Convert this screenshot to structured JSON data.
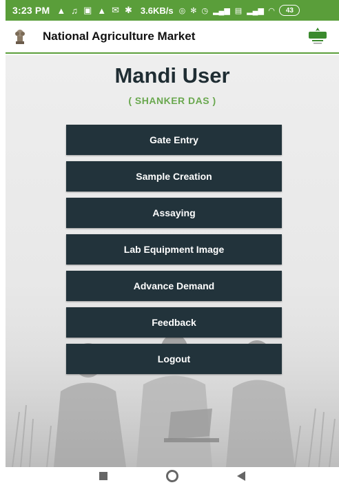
{
  "status_bar": {
    "time": "3:23 PM",
    "speed": "3.6KB/s",
    "battery": "43",
    "icons": [
      "warning-icon",
      "notification-icon",
      "download-icon",
      "warning-icon",
      "mail-icon",
      "fan-icon"
    ],
    "right_icons": [
      "hotspot-icon",
      "bluetooth-icon",
      "alarm-icon",
      "signal-icon",
      "volte-icon",
      "signal-icon",
      "wifi-icon"
    ]
  },
  "app_bar": {
    "title": "National Agriculture Market",
    "logo_text": "eNAM"
  },
  "page": {
    "heading": "Mandi User",
    "user_name": "( SHANKER DAS )"
  },
  "menu": [
    {
      "label": "Gate Entry"
    },
    {
      "label": "Sample Creation"
    },
    {
      "label": "Assaying"
    },
    {
      "label": "Lab Equipment Image"
    },
    {
      "label": "Advance Demand"
    },
    {
      "label": "Feedback"
    },
    {
      "label": "Logout"
    }
  ],
  "colors": {
    "accent": "#5a9e3a",
    "button": "#22333b",
    "heading": "#1f2d33",
    "user_name": "#6aa84f"
  }
}
